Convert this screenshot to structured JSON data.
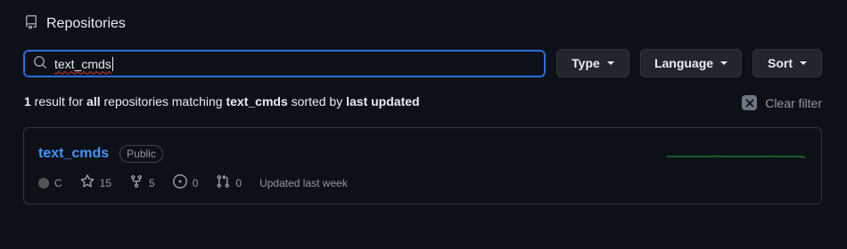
{
  "header": {
    "title": "Repositories",
    "icon": "repo-icon"
  },
  "search": {
    "value": "text_cmds",
    "icon": "search-icon"
  },
  "filters": {
    "type_label": "Type",
    "language_label": "Language",
    "sort_label": "Sort"
  },
  "summary": {
    "count": "1",
    "text1": " result for ",
    "scope": "all",
    "text2": " repositories matching ",
    "query": "text_cmds",
    "text3": " sorted by ",
    "sort": "last updated"
  },
  "clear_filter": {
    "label": "Clear filter"
  },
  "repo": {
    "name": "text_cmds",
    "visibility": "Public",
    "language": "C",
    "language_color": "#555555",
    "stars": "15",
    "forks": "5",
    "issues": "0",
    "pull_requests": "0",
    "updated": "Updated last week"
  },
  "colors": {
    "background": "#0d1117",
    "link": "#4493f8",
    "border": "#30363d",
    "sparkline": "#238636"
  }
}
